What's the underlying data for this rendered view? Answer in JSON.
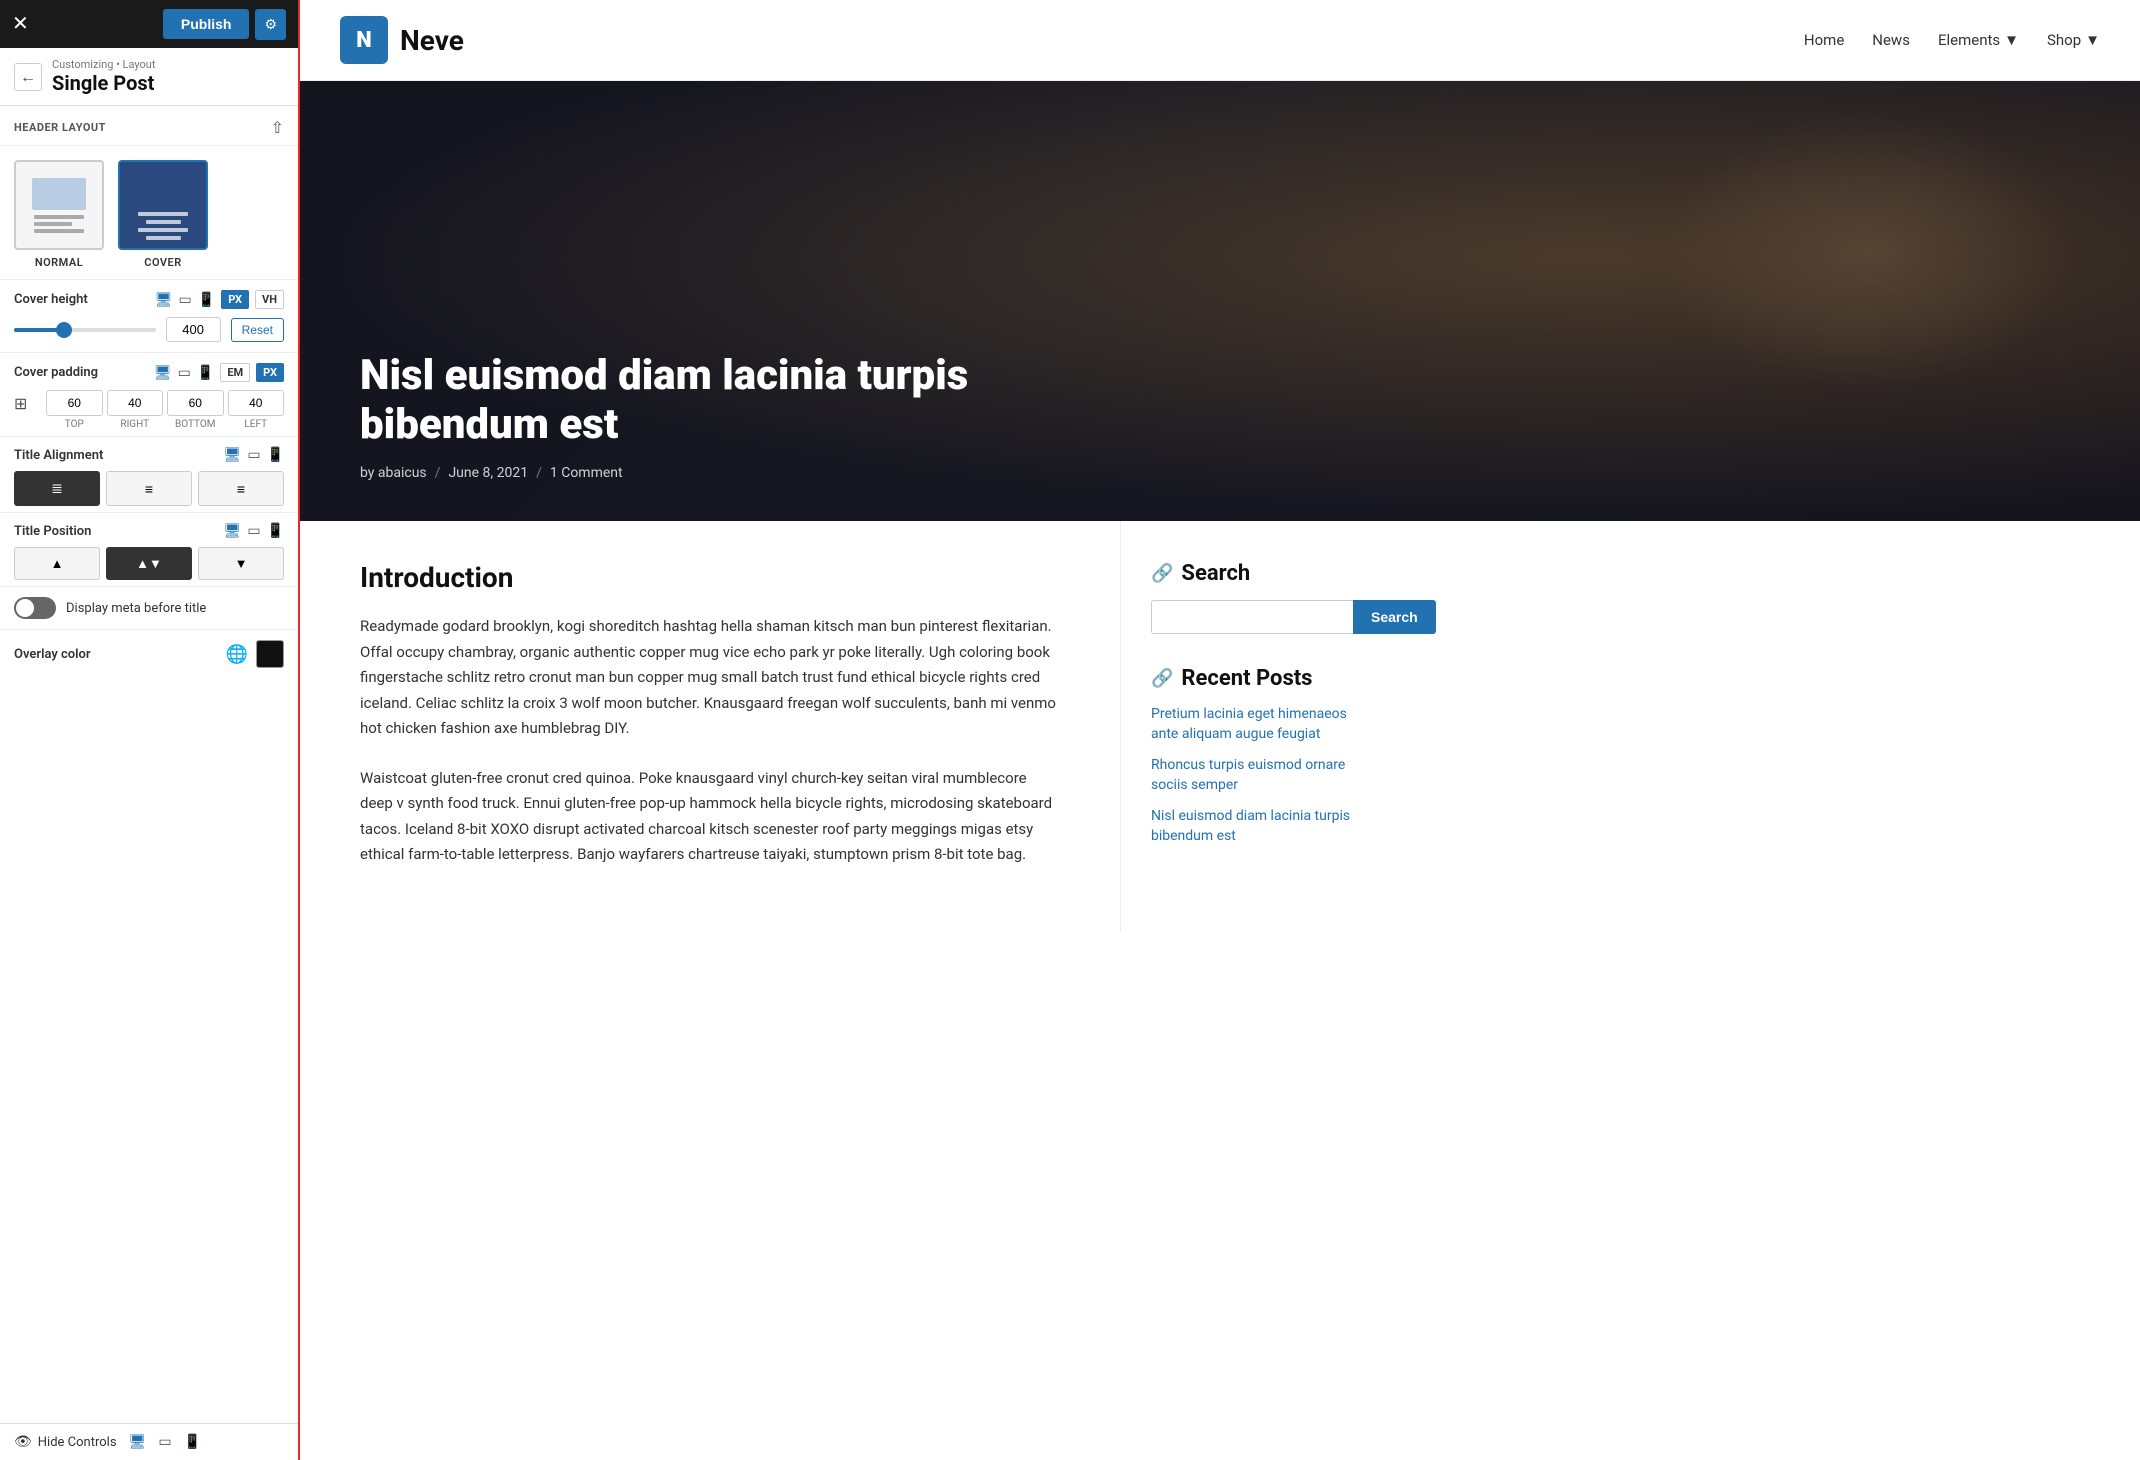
{
  "topbar": {
    "close_label": "✕",
    "publish_label": "Publish",
    "gear_label": "⚙"
  },
  "breadcrumb": {
    "sub": "Customizing • Layout",
    "title": "Single Post"
  },
  "panel": {
    "section_header_layout": "HEADER LAYOUT",
    "layout_normal_label": "NORMAL",
    "layout_cover_label": "COVER",
    "cover_height_label": "Cover height",
    "cover_height_value": "400",
    "cover_height_reset": "Reset",
    "cover_height_unit_px": "PX",
    "cover_height_unit_vh": "VH",
    "cover_padding_label": "Cover padding",
    "cover_padding_unit_em": "EM",
    "cover_padding_unit_px": "PX",
    "cover_padding_top": "60",
    "cover_padding_right": "40",
    "cover_padding_bottom": "60",
    "cover_padding_left": "40",
    "padding_label_top": "TOP",
    "padding_label_right": "RIGHT",
    "padding_label_bottom": "BOTTOM",
    "padding_label_left": "LEFT",
    "title_alignment_label": "Title Alignment",
    "title_position_label": "Title Position",
    "display_meta_label": "Display meta before title",
    "overlay_color_label": "Overlay color",
    "hide_controls_label": "Hide Controls"
  },
  "site": {
    "logo_letter": "N",
    "site_name": "Neve",
    "nav": [
      {
        "label": "Home"
      },
      {
        "label": "News"
      },
      {
        "label": "Elements"
      },
      {
        "label": "Shop"
      }
    ]
  },
  "post": {
    "hero_title": "Nisl euismod diam lacinia turpis bibendum est",
    "meta_by": "by abaicus",
    "meta_date": "June 8, 2021",
    "meta_comment": "1 Comment",
    "intro_heading": "Introduction",
    "intro_text1": "Readymade godard brooklyn, kogi shoreditch hashtag hella shaman kitsch man bun pinterest flexitarian. Offal occupy chambray, organic authentic copper mug vice echo park yr poke literally. Ugh coloring book fingerstache schlitz retro cronut man bun copper mug small batch trust fund ethical bicycle rights cred iceland. Celiac schlitz la croix 3 wolf moon butcher. Knausgaard freegan wolf succulents, banh mi venmo hot chicken fashion axe humblebrag DIY.",
    "intro_text2": "Waistcoat gluten-free cronut cred quinoa. Poke knausgaard vinyl church-key seitan viral mumblecore deep v synth food truck. Ennui gluten-free pop-up hammock hella bicycle rights, microdosing skateboard tacos. Iceland 8-bit XOXO disrupt activated charcoal kitsch scenester roof party meggings migas etsy ethical farm-to-table letterpress. Banjo wayfarers chartreuse taiyaki, stumptown prism 8-bit tote bag."
  },
  "sidebar": {
    "search_title": "Search",
    "search_placeholder": "",
    "search_button": "Search",
    "recent_title": "Recent Posts",
    "recent_posts": [
      "Pretium lacinia eget himenaeos ante aliquam augue feugiat",
      "Rhoncus turpis euismod ornare sociis semper",
      "Nisl euismod diam lacinia turpis bibendum est"
    ]
  }
}
